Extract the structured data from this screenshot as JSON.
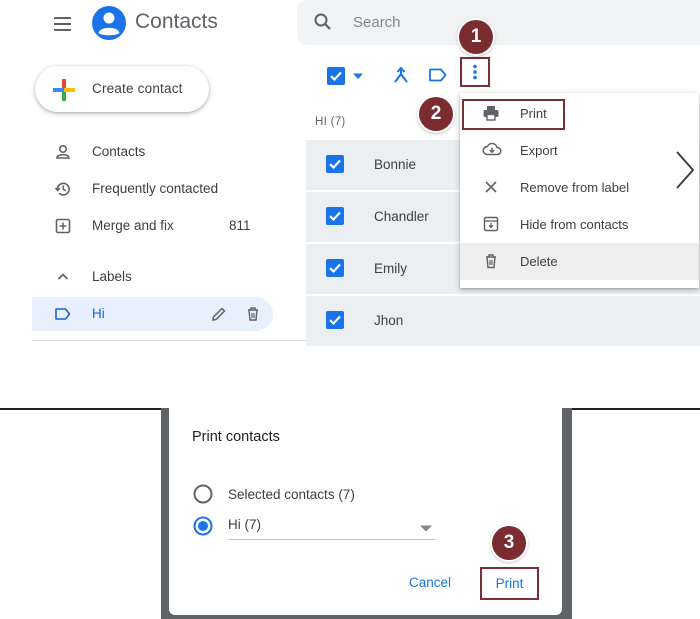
{
  "app": {
    "title": "Contacts"
  },
  "search": {
    "placeholder": "Search"
  },
  "sidebar": {
    "create_label": "Create contact",
    "items": [
      {
        "label": "Contacts",
        "icon": "person-icon"
      },
      {
        "label": "Frequently contacted",
        "icon": "history-icon"
      },
      {
        "label": "Merge and fix",
        "icon": "merge-fix-icon",
        "count": "811"
      }
    ],
    "labels_heading": "Labels",
    "label_items": [
      {
        "label": "Hi",
        "icon": "label-icon"
      }
    ]
  },
  "list": {
    "header": "HI (7)",
    "contacts": [
      "Bonnie",
      "Chandler",
      "Emily",
      "Jhon"
    ]
  },
  "menu": {
    "items": [
      {
        "label": "Print",
        "icon": "print-icon"
      },
      {
        "label": "Export",
        "icon": "cloud-download-icon"
      },
      {
        "label": "Remove from label",
        "icon": "close-icon"
      },
      {
        "label": "Hide from contacts",
        "icon": "archive-icon"
      },
      {
        "label": "Delete",
        "icon": "trash-icon"
      }
    ]
  },
  "dialog": {
    "title": "Print contacts",
    "options": [
      {
        "label": "Selected contacts (7)",
        "selected": false
      },
      {
        "label": "Hi (7)",
        "selected": true
      }
    ],
    "cancel_label": "Cancel",
    "print_label": "Print"
  },
  "steps": [
    "1",
    "2",
    "3"
  ],
  "colors": {
    "accent": "#1a73e8",
    "step_badge": "#7a2c31",
    "highlight_border": "#7b2e33",
    "selected_row": "#eceff1"
  }
}
